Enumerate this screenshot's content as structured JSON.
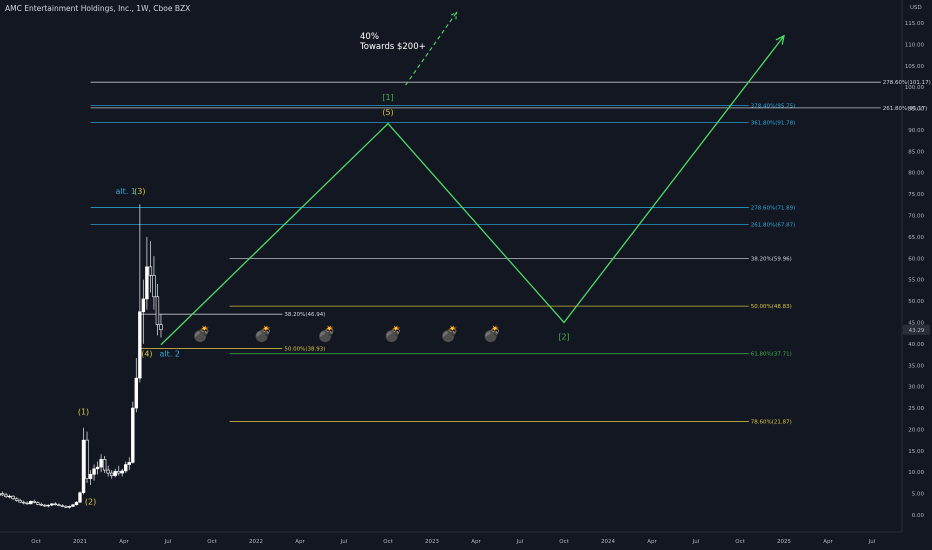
{
  "header": {
    "title": "AMC Entertainment Holdings, Inc., 1W, Cboe BZX"
  },
  "axis": {
    "currency": "USD"
  },
  "annotation": {
    "line1": "40%",
    "line2": "Towards $200+"
  },
  "colors": {
    "background": "#131722",
    "up": "#ffffff",
    "down": "#ffffff",
    "path": "#4cd964",
    "blue": "#2ea8d6",
    "gold": "#d9c743",
    "white": "#d1d4dc",
    "green": "#3fb24b"
  },
  "icons": {
    "bomb": "💣"
  },
  "chart_data": {
    "type": "candlestick",
    "symbol": "AMC",
    "timeframe": "1W",
    "ylim": [
      0,
      117
    ],
    "y_ticks": [
      0,
      5,
      10,
      15,
      20,
      25,
      30,
      35,
      40,
      45,
      50,
      55,
      60,
      65,
      70,
      75,
      80,
      85,
      90,
      95,
      100,
      105,
      110,
      115
    ],
    "x_ticks": [
      "Oct",
      "2021",
      "Apr",
      "Jul",
      "Oct",
      "2022",
      "Apr",
      "Jul",
      "Oct",
      "2023",
      "Apr",
      "Jul",
      "Oct",
      "2024",
      "Apr",
      "Jul",
      "Oct",
      "2025",
      "Apr",
      "Jul"
    ],
    "x_tick_times": [
      2019.75,
      2020.0,
      2020.25,
      2020.5,
      2020.75,
      2021.0,
      2021.25,
      2021.5,
      2021.75,
      2022.0,
      2022.25,
      2022.5,
      2022.75,
      2023.0,
      2023.25,
      2023.5,
      2023.75,
      2024.0,
      2024.25,
      2024.5
    ],
    "last_price": "43.29",
    "ohlc": [
      {
        "t": 2019.4,
        "o": 2.1,
        "h": 2.5,
        "l": 1.8,
        "c": 2.3
      },
      {
        "t": 2019.42,
        "o": 2.3,
        "h": 2.7,
        "l": 2.1,
        "c": 2.6
      },
      {
        "t": 2019.44,
        "o": 2.6,
        "h": 3.1,
        "l": 2.4,
        "c": 3.0
      },
      {
        "t": 2019.46,
        "o": 3.0,
        "h": 3.4,
        "l": 2.8,
        "c": 3.3
      },
      {
        "t": 2019.48,
        "o": 3.3,
        "h": 3.9,
        "l": 3.1,
        "c": 3.8
      },
      {
        "t": 2019.5,
        "o": 3.8,
        "h": 4.5,
        "l": 3.6,
        "c": 4.2
      },
      {
        "t": 2019.52,
        "o": 4.2,
        "h": 4.8,
        "l": 3.9,
        "c": 4.6
      },
      {
        "t": 2019.54,
        "o": 4.6,
        "h": 5.3,
        "l": 4.3,
        "c": 5.0
      },
      {
        "t": 2019.56,
        "o": 5.0,
        "h": 5.5,
        "l": 4.4,
        "c": 4.7
      },
      {
        "t": 2019.58,
        "o": 4.7,
        "h": 5.2,
        "l": 4.0,
        "c": 4.3
      },
      {
        "t": 2019.6,
        "o": 4.3,
        "h": 4.8,
        "l": 3.9,
        "c": 4.4
      },
      {
        "t": 2019.62,
        "o": 4.4,
        "h": 4.6,
        "l": 3.5,
        "c": 3.8
      },
      {
        "t": 2019.64,
        "o": 3.8,
        "h": 4.1,
        "l": 3.1,
        "c": 3.4
      },
      {
        "t": 2019.66,
        "o": 3.4,
        "h": 3.8,
        "l": 2.8,
        "c": 3.0
      },
      {
        "t": 2019.68,
        "o": 3.0,
        "h": 3.4,
        "l": 2.5,
        "c": 2.8
      },
      {
        "t": 2019.7,
        "o": 2.8,
        "h": 3.2,
        "l": 2.4,
        "c": 2.6
      },
      {
        "t": 2019.72,
        "o": 2.6,
        "h": 3.4,
        "l": 2.5,
        "c": 3.2
      },
      {
        "t": 2019.74,
        "o": 3.2,
        "h": 3.6,
        "l": 2.7,
        "c": 2.9
      },
      {
        "t": 2019.76,
        "o": 2.9,
        "h": 3.2,
        "l": 2.3,
        "c": 2.5
      },
      {
        "t": 2019.78,
        "o": 2.5,
        "h": 2.9,
        "l": 2.1,
        "c": 2.3
      },
      {
        "t": 2019.8,
        "o": 2.3,
        "h": 2.6,
        "l": 1.9,
        "c": 2.1
      },
      {
        "t": 2019.82,
        "o": 2.1,
        "h": 2.5,
        "l": 1.8,
        "c": 2.3
      },
      {
        "t": 2019.84,
        "o": 2.3,
        "h": 2.8,
        "l": 2.1,
        "c": 2.6
      },
      {
        "t": 2019.86,
        "o": 2.6,
        "h": 3.0,
        "l": 2.2,
        "c": 2.4
      },
      {
        "t": 2019.88,
        "o": 2.4,
        "h": 2.7,
        "l": 2.0,
        "c": 2.2
      },
      {
        "t": 2019.9,
        "o": 2.2,
        "h": 2.5,
        "l": 1.8,
        "c": 2.0
      },
      {
        "t": 2019.92,
        "o": 2.0,
        "h": 2.3,
        "l": 1.6,
        "c": 1.8
      },
      {
        "t": 2019.94,
        "o": 1.8,
        "h": 2.2,
        "l": 1.5,
        "c": 2.0
      },
      {
        "t": 2019.96,
        "o": 2.0,
        "h": 2.6,
        "l": 1.9,
        "c": 2.4
      },
      {
        "t": 2019.98,
        "o": 2.4,
        "h": 3.2,
        "l": 2.2,
        "c": 3.0
      },
      {
        "t": 2020.0,
        "o": 3.0,
        "h": 5.5,
        "l": 2.8,
        "c": 5.2
      },
      {
        "t": 2020.02,
        "o": 5.2,
        "h": 20.4,
        "l": 4.8,
        "c": 17.5
      },
      {
        "t": 2020.04,
        "o": 17.5,
        "h": 19.5,
        "l": 7.5,
        "c": 8.5
      },
      {
        "t": 2020.06,
        "o": 8.5,
        "h": 10.5,
        "l": 7.0,
        "c": 9.5
      },
      {
        "t": 2020.08,
        "o": 9.5,
        "h": 11.8,
        "l": 8.0,
        "c": 10.8
      },
      {
        "t": 2020.1,
        "o": 10.8,
        "h": 12.5,
        "l": 9.5,
        "c": 11.2
      },
      {
        "t": 2020.12,
        "o": 11.2,
        "h": 14.2,
        "l": 10.0,
        "c": 13.0
      },
      {
        "t": 2020.14,
        "o": 13.0,
        "h": 13.8,
        "l": 9.8,
        "c": 10.5
      },
      {
        "t": 2020.16,
        "o": 10.5,
        "h": 11.5,
        "l": 9.0,
        "c": 9.8
      },
      {
        "t": 2020.18,
        "o": 9.8,
        "h": 10.5,
        "l": 8.5,
        "c": 9.2
      },
      {
        "t": 2020.2,
        "o": 9.2,
        "h": 10.8,
        "l": 8.8,
        "c": 10.2
      },
      {
        "t": 2020.22,
        "o": 10.2,
        "h": 11.5,
        "l": 9.2,
        "c": 9.8
      },
      {
        "t": 2020.24,
        "o": 9.8,
        "h": 10.8,
        "l": 9.0,
        "c": 10.3
      },
      {
        "t": 2020.26,
        "o": 10.3,
        "h": 12.5,
        "l": 9.8,
        "c": 11.8
      },
      {
        "t": 2020.28,
        "o": 11.8,
        "h": 13.5,
        "l": 10.5,
        "c": 12.3
      },
      {
        "t": 2020.3,
        "o": 12.3,
        "h": 26.5,
        "l": 12.0,
        "c": 25.0
      },
      {
        "t": 2020.32,
        "o": 25.0,
        "h": 36.7,
        "l": 24.0,
        "c": 32.0
      },
      {
        "t": 2020.34,
        "o": 32.0,
        "h": 72.6,
        "l": 31.0,
        "c": 47.5
      },
      {
        "t": 2020.36,
        "o": 47.5,
        "h": 55.0,
        "l": 40.0,
        "c": 50.5
      },
      {
        "t": 2020.38,
        "o": 50.5,
        "h": 65.0,
        "l": 48.0,
        "c": 58.0
      },
      {
        "t": 2020.4,
        "o": 58.0,
        "h": 64.0,
        "l": 52.0,
        "c": 56.0
      },
      {
        "t": 2020.42,
        "o": 56.0,
        "h": 60.5,
        "l": 48.0,
        "c": 51.0
      },
      {
        "t": 2020.44,
        "o": 51.0,
        "h": 54.0,
        "l": 42.0,
        "c": 44.5
      },
      {
        "t": 2020.46,
        "o": 44.5,
        "h": 47.0,
        "l": 41.5,
        "c": 43.3
      }
    ],
    "fib_levels": [
      {
        "label": "278.60%(101.17)",
        "value": 101.17,
        "color": "white",
        "x0": 2020.06,
        "x1": 2024.55
      },
      {
        "label": "378.40%(95.75)",
        "value": 95.75,
        "color": "blue",
        "x0": 2020.06,
        "x1": 2023.8
      },
      {
        "label": "261.80%(95.17)",
        "value": 95.17,
        "color": "white",
        "x0": 2020.06,
        "x1": 2024.55
      },
      {
        "label": "361.80%(91.78)",
        "value": 91.78,
        "color": "blue",
        "x0": 2020.06,
        "x1": 2023.8
      },
      {
        "label": "278.60%(71.89)",
        "value": 71.89,
        "color": "blue",
        "x0": 2020.06,
        "x1": 2023.8
      },
      {
        "label": "261.80%(67.87)",
        "value": 67.87,
        "color": "blue",
        "x0": 2020.06,
        "x1": 2023.8
      },
      {
        "label": "38.20%(59.96)",
        "value": 59.96,
        "color": "white",
        "x0": 2020.85,
        "x1": 2023.8
      },
      {
        "label": "50.00%(48.83)",
        "value": 48.83,
        "color": "gold",
        "x0": 2020.85,
        "x1": 2023.8
      },
      {
        "label": "38.20%(46.94)",
        "value": 46.94,
        "color": "white",
        "x0": 2020.34,
        "x1": 2021.15
      },
      {
        "label": "50.00%(38.93)",
        "value": 38.93,
        "color": "gold",
        "x0": 2020.34,
        "x1": 2021.15
      },
      {
        "label": "61.80%(37.71)",
        "value": 37.71,
        "color": "green",
        "x0": 2020.85,
        "x1": 2023.8
      },
      {
        "label": "78.60%(21.87)",
        "value": 21.87,
        "color": "gold",
        "x0": 2020.85,
        "x1": 2023.8
      }
    ],
    "projection_path": [
      {
        "t": 2020.46,
        "v": 39.8
      },
      {
        "t": 2021.75,
        "v": 91.5
      },
      {
        "t": 2022.75,
        "v": 45.0
      },
      {
        "t": 2024.0,
        "v": 112.0
      }
    ],
    "dashed_projection": [
      {
        "t": 2021.85,
        "v": 100.5
      },
      {
        "t": 2022.14,
        "v": 117.5
      }
    ],
    "wave_labels": [
      {
        "text": "(1)",
        "t": 2020.02,
        "v": 23.5,
        "color": "gold"
      },
      {
        "text": "(2)",
        "t": 2020.06,
        "v": 2.5,
        "color": "gold"
      },
      {
        "text": "(3)",
        "t": 2020.34,
        "v": 75.0,
        "color": "gold"
      },
      {
        "text": "alt. 1",
        "t": 2020.26,
        "v": 75.0,
        "color": "blue"
      },
      {
        "text": "(4)",
        "t": 2020.38,
        "v": 37.0,
        "color": "gold"
      },
      {
        "text": "alt. 2",
        "t": 2020.51,
        "v": 37.0,
        "color": "blue"
      },
      {
        "text": "[1]",
        "t": 2021.75,
        "v": 97.0,
        "color": "green"
      },
      {
        "text": "(5)",
        "t": 2021.75,
        "v": 93.5,
        "color": "gold"
      },
      {
        "text": "[2]",
        "t": 2022.75,
        "v": 41.0,
        "color": "green"
      }
    ],
    "bombs": [
      2020.69,
      2021.04,
      2021.4,
      2021.78,
      2022.1,
      2022.34
    ],
    "bomb_value": 42.5
  }
}
